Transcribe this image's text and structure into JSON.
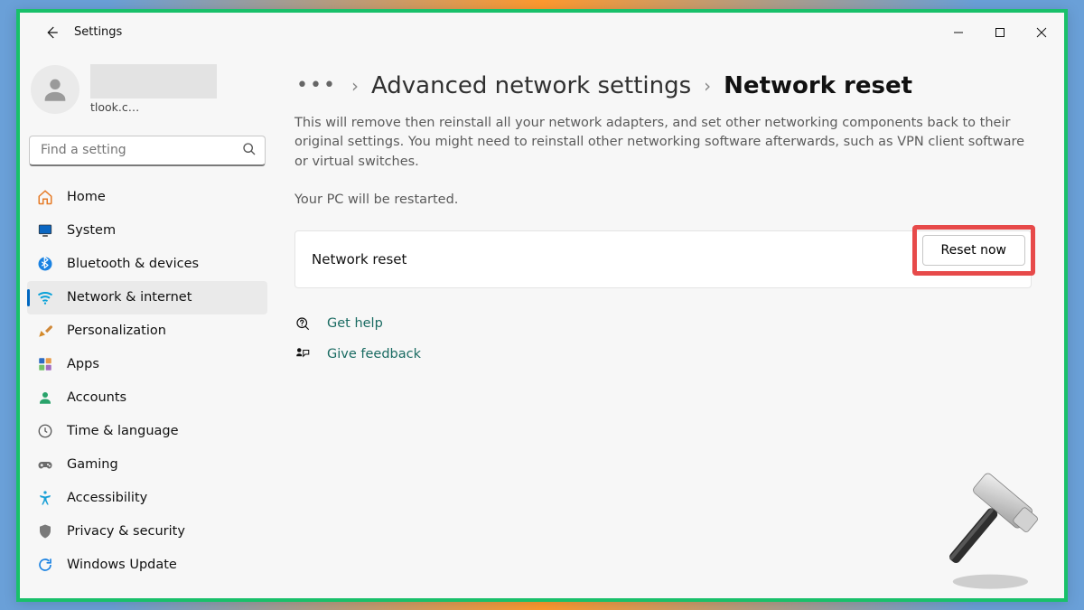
{
  "window": {
    "title": "Settings"
  },
  "profile": {
    "email": "tlook.c…"
  },
  "search": {
    "placeholder": "Find a setting"
  },
  "sidebar": {
    "items": [
      {
        "label": "Home",
        "icon": "home-icon",
        "color": "#e67b27"
      },
      {
        "label": "System",
        "icon": "system-icon",
        "color": "#0a66c2"
      },
      {
        "label": "Bluetooth & devices",
        "icon": "bluetooth-icon",
        "color": "#1a82e2"
      },
      {
        "label": "Network & internet",
        "icon": "wifi-icon",
        "color": "#0aa2d9",
        "active": true
      },
      {
        "label": "Personalization",
        "icon": "personalization-icon",
        "color": "#d48a2a"
      },
      {
        "label": "Apps",
        "icon": "apps-icon",
        "color": "#2d6bc2"
      },
      {
        "label": "Accounts",
        "icon": "accounts-icon",
        "color": "#29a36b"
      },
      {
        "label": "Time & language",
        "icon": "time-language-icon",
        "color": "#5b5b5b"
      },
      {
        "label": "Gaming",
        "icon": "gaming-icon",
        "color": "#6b6b6b"
      },
      {
        "label": "Accessibility",
        "icon": "accessibility-icon",
        "color": "#1aa0d6"
      },
      {
        "label": "Privacy & security",
        "icon": "privacy-icon",
        "color": "#7a7a7a"
      },
      {
        "label": "Windows Update",
        "icon": "windows-update-icon",
        "color": "#1a82e2"
      }
    ]
  },
  "breadcrumb": {
    "prev": "Advanced network settings",
    "current": "Network reset"
  },
  "content": {
    "description": "This will remove then reinstall all your network adapters, and set other networking components back to their original settings. You might need to reinstall other networking software afterwards, such as VPN client software or virtual switches.",
    "restart_note": "Your PC will be restarted.",
    "card_title": "Network reset",
    "reset_button": "Reset now"
  },
  "links": {
    "help": "Get help",
    "feedback": "Give feedback"
  }
}
